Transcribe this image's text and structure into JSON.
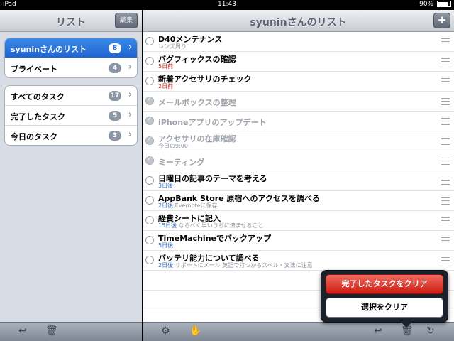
{
  "status_bar": {
    "carrier": "iPad",
    "time": "11:43",
    "battery": "90%"
  },
  "left": {
    "title": "リスト",
    "edit_label": "編集",
    "lists": [
      {
        "label": "syuninさんのリスト",
        "count": "8",
        "selected": true
      },
      {
        "label": "プライベート",
        "count": "4"
      }
    ],
    "filters": [
      {
        "label": "すべてのタスク",
        "count": "17"
      },
      {
        "label": "完了したタスク",
        "count": "5"
      },
      {
        "label": "今日のタスク",
        "count": "3"
      }
    ]
  },
  "right": {
    "title": "syuninさんのリスト",
    "tasks": [
      {
        "title": "D40メンテナンス",
        "sub_note": "レンズ周り"
      },
      {
        "title": "バグフィックスの確認",
        "sub_due": "5日前",
        "due_color": "red"
      },
      {
        "title": "新着アクセサリのチェック",
        "sub_due": "2日前",
        "due_color": "red"
      },
      {
        "title": "メールボックスの整理",
        "done": true
      },
      {
        "title": "iPhoneアプリのアップデート",
        "done": true
      },
      {
        "title": "アクセサリの在庫確認",
        "done": true,
        "sub_note": "今日の9:00"
      },
      {
        "title": "ミーティング",
        "done": true
      },
      {
        "title": "日曜日の記事のテーマを考える",
        "sub_due": "3日後"
      },
      {
        "title": "AppBank Store 原宿へのアクセスを調べる",
        "sub_due": "2日後",
        "sub_note": "Evernoteに保存"
      },
      {
        "title": "経費シートに記入",
        "sub_due": "15日後",
        "sub_note": "なるべく早いうちに済ませること"
      },
      {
        "title": "TimeMachineでバックアップ",
        "sub_due": "5日後"
      },
      {
        "title": "バッテリ能力について調べる",
        "sub_due": "2日後",
        "sub_note": "サポートにメール 英語で打つからスペル・文法に注意"
      }
    ]
  },
  "popover": {
    "clear_completed": "完了したタスクをクリア",
    "clear_selection": "選択をクリア"
  },
  "colors": {
    "selected_blue": "#1f63d2",
    "due_red": "#d9261c",
    "popover_red": "#cc1d13"
  }
}
